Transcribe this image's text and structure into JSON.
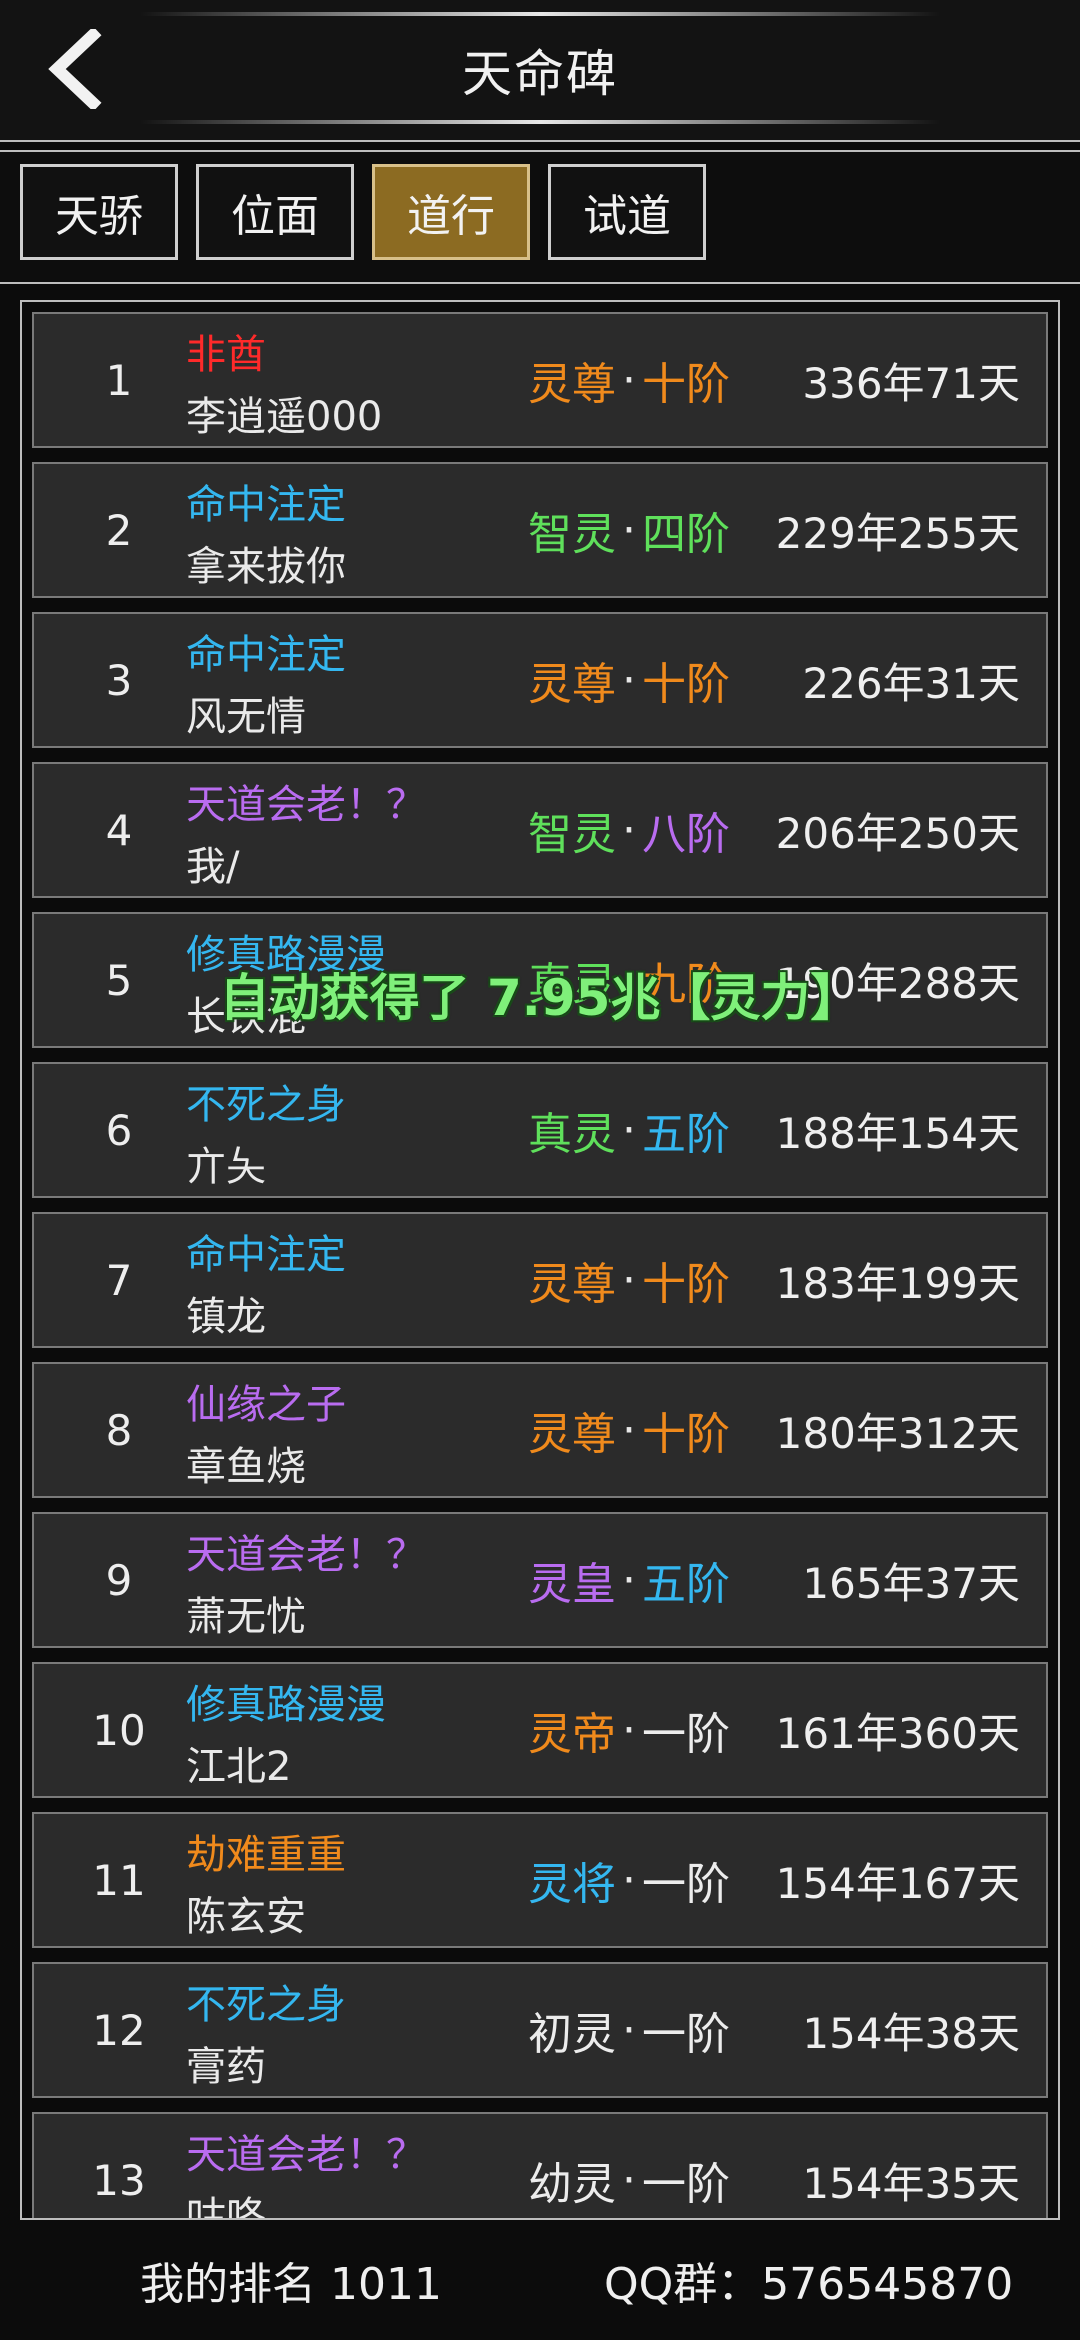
{
  "header": {
    "title": "天命碑",
    "back_icon": "chevron-left-icon"
  },
  "tabs": [
    {
      "label": "天骄",
      "active": false
    },
    {
      "label": "位面",
      "active": false
    },
    {
      "label": "道行",
      "active": true
    },
    {
      "label": "试道",
      "active": false
    }
  ],
  "colors": {
    "red": "#ff2a2a",
    "cyan": "#34b7f0",
    "purple": "#b96cf0",
    "orange": "#f08a1c",
    "green": "#5fe05b",
    "white": "#ececec",
    "active_tab": "#8c6b22"
  },
  "rows": [
    {
      "rank": "1",
      "title": "非酋",
      "title_color": "#ff2a2a",
      "name": "李逍遥000",
      "realm": "灵尊",
      "realm_color": "#f08a1c",
      "stage": "十阶",
      "stage_color": "#f08a1c",
      "time": "336年71天"
    },
    {
      "rank": "2",
      "title": "命中注定",
      "title_color": "#34b7f0",
      "name": "拿来拔你",
      "realm": "智灵",
      "realm_color": "#5fe05b",
      "stage": "四阶",
      "stage_color": "#5fe05b",
      "time": "229年255天"
    },
    {
      "rank": "3",
      "title": "命中注定",
      "title_color": "#34b7f0",
      "name": "风无情",
      "realm": "灵尊",
      "realm_color": "#f08a1c",
      "stage": "十阶",
      "stage_color": "#f08a1c",
      "time": "226年31天"
    },
    {
      "rank": "4",
      "title": "天道会老！？",
      "title_color": "#b96cf0",
      "name": "我/",
      "realm": "智灵",
      "realm_color": "#5fe05b",
      "stage": "八阶",
      "stage_color": "#b96cf0",
      "time": "206年250天"
    },
    {
      "rank": "5",
      "title": "修真路漫漫",
      "title_color": "#34b7f0",
      "name": "长铗混",
      "realm": "真灵",
      "realm_color": "#5fe05b",
      "stage": "九阶",
      "stage_color": "#f08a1c",
      "time": "190年288天"
    },
    {
      "rank": "6",
      "title": "不死之身",
      "title_color": "#34b7f0",
      "name": "亣夨",
      "realm": "真灵",
      "realm_color": "#5fe05b",
      "stage": "五阶",
      "stage_color": "#34b7f0",
      "time": "188年154天"
    },
    {
      "rank": "7",
      "title": "命中注定",
      "title_color": "#34b7f0",
      "name": "镇龙",
      "realm": "灵尊",
      "realm_color": "#f08a1c",
      "stage": "十阶",
      "stage_color": "#f08a1c",
      "time": "183年199天"
    },
    {
      "rank": "8",
      "title": "仙缘之子",
      "title_color": "#b96cf0",
      "name": "章鱼烧",
      "realm": "灵尊",
      "realm_color": "#f08a1c",
      "stage": "十阶",
      "stage_color": "#f08a1c",
      "time": "180年312天"
    },
    {
      "rank": "9",
      "title": "天道会老！？",
      "title_color": "#b96cf0",
      "name": "萧无忧",
      "realm": "灵皇",
      "realm_color": "#b96cf0",
      "stage": "五阶",
      "stage_color": "#34b7f0",
      "time": "165年37天"
    },
    {
      "rank": "10",
      "title": "修真路漫漫",
      "title_color": "#34b7f0",
      "name": "江北2",
      "realm": "灵帝",
      "realm_color": "#f08a1c",
      "stage": "一阶",
      "stage_color": "#ececec",
      "time": "161年360天"
    },
    {
      "rank": "11",
      "title": "劫难重重",
      "title_color": "#f08a1c",
      "name": "陈玄安",
      "realm": "灵将",
      "realm_color": "#34b7f0",
      "stage": "一阶",
      "stage_color": "#ececec",
      "time": "154年167天"
    },
    {
      "rank": "12",
      "title": "不死之身",
      "title_color": "#34b7f0",
      "name": "膏药",
      "realm": "初灵",
      "realm_color": "#ececec",
      "stage": "一阶",
      "stage_color": "#ececec",
      "time": "154年38天"
    },
    {
      "rank": "13",
      "title": "天道会老！？",
      "title_color": "#b96cf0",
      "name": "咕咚",
      "realm": "幼灵",
      "realm_color": "#ececec",
      "stage": "一阶",
      "stage_color": "#ececec",
      "time": "154年35天"
    }
  ],
  "realm_separator": "·",
  "toast": {
    "text": "自动获得了 7.95兆【灵力】"
  },
  "footer": {
    "my_rank": "我的排名 1011",
    "qq_group": "QQ群：576545870"
  }
}
